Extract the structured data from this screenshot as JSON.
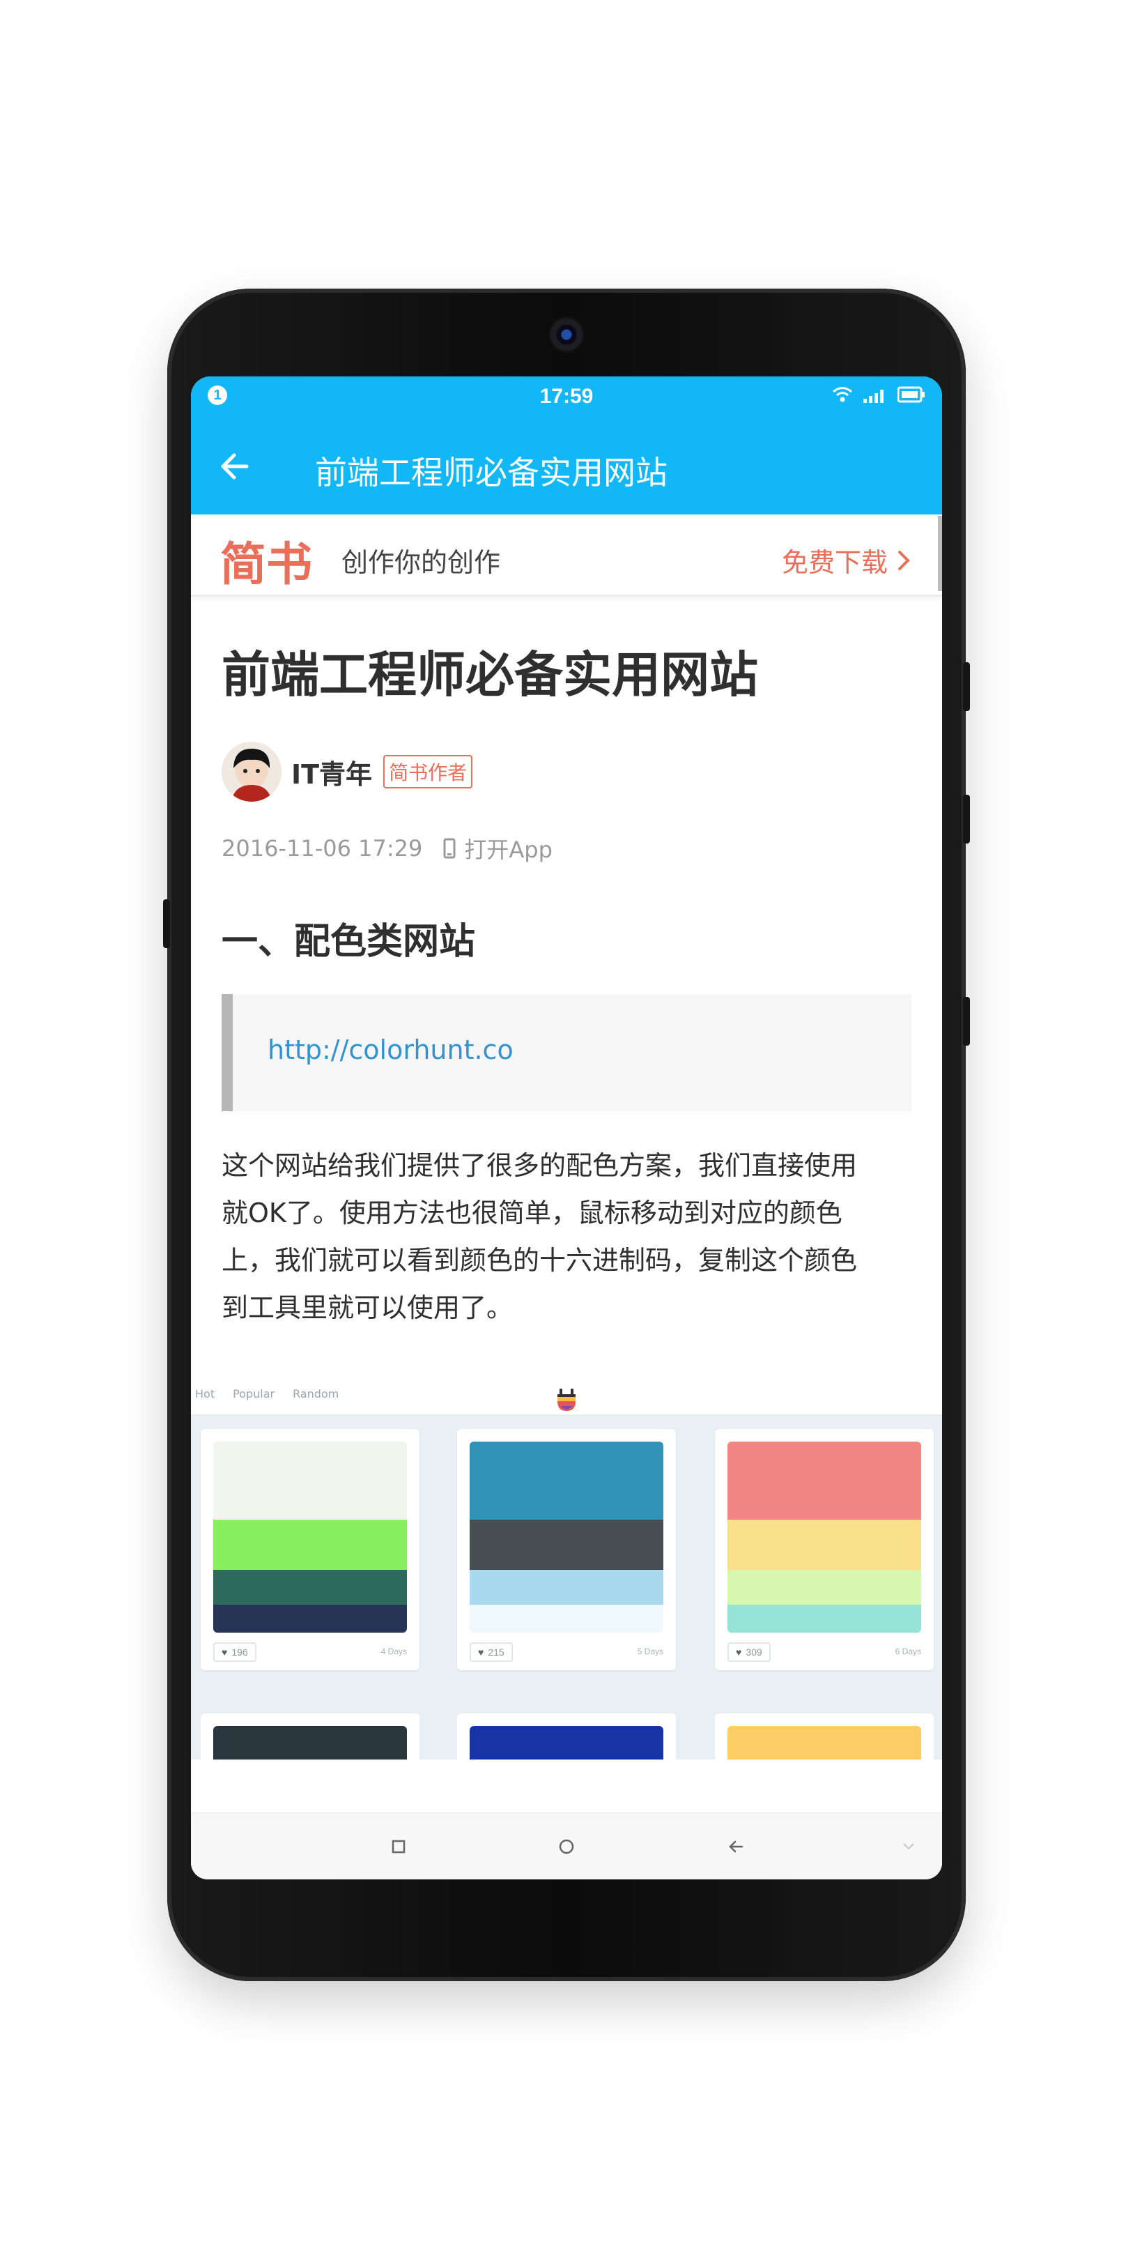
{
  "status_bar": {
    "notification_badge": "1",
    "time": "17:59",
    "icons": [
      "wifi-icon",
      "signal-icon",
      "battery-icon"
    ]
  },
  "app_bar": {
    "title": "前端工程师必备实用网站",
    "back_icon": "arrow-left-icon",
    "color": "#12b7f5"
  },
  "promo_banner": {
    "logo": "简书",
    "tagline": "创作你的创作",
    "download_label": "免费下载",
    "accent": "#ea6f5a"
  },
  "article": {
    "title": "前端工程师必备实用网站",
    "author": {
      "name": "IT青年",
      "badge": "简书作者"
    },
    "date": "2016-11-06 17:29",
    "open_app_label": "打开App",
    "section_heading": "一、配色类网站",
    "quote_link": "http://colorhunt.co",
    "paragraph_lines": [
      "这个网站给我们提供了很多的配色方案，我们直接使用",
      "就OK了。使用方法也很简单，鼠标移动到对应的颜色",
      "上，我们就可以看到颜色的十六进制码，复制这个颜色",
      "到工具里就可以使用了。"
    ]
  },
  "embedded_screenshot": {
    "nav": [
      "Hot",
      "Popular",
      "Random"
    ],
    "palettes": [
      {
        "colors": [
          "#f2f4ee",
          "#88ef5e",
          "#2d6a5c",
          "#273457"
        ],
        "likes": "196",
        "age": "4 Days"
      },
      {
        "colors": [
          "#3192b8",
          "#474e53",
          "#a8d9ef",
          "#eef8fd"
        ],
        "likes": "215",
        "age": "5 Days"
      },
      {
        "colors": [
          "#f28682",
          "#fbe08c",
          "#d6f7b0",
          "#95e3d6"
        ],
        "likes": "309",
        "age": "6 Days"
      }
    ],
    "partial_palettes": [
      "#2a363d",
      "#1733a6",
      "#fdcd65"
    ]
  },
  "system_nav": {
    "buttons": [
      "recents-icon",
      "home-icon",
      "back-icon"
    ]
  }
}
